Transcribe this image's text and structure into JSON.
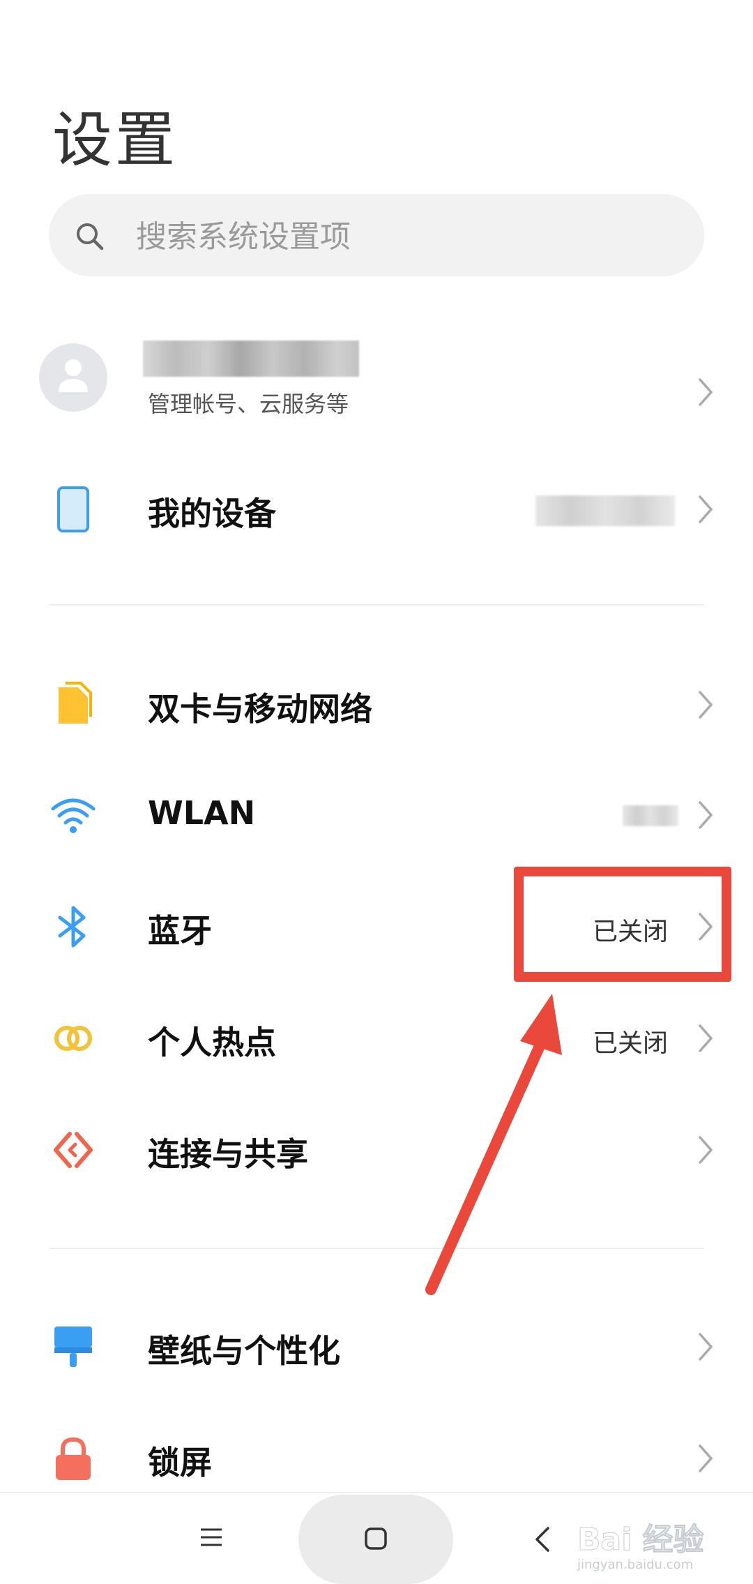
{
  "page": {
    "title": "设置"
  },
  "search": {
    "placeholder": "搜索系统设置项",
    "icon": "search-icon"
  },
  "account": {
    "subtitle": "管理帐号、云服务等",
    "icon": "avatar-icon"
  },
  "device": {
    "label": "我的设备",
    "icon": "phone-icon"
  },
  "network": [
    {
      "label": "双卡与移动网络",
      "value": "",
      "icon": "sim-card-icon",
      "color": "#ffc233"
    },
    {
      "label": "WLAN",
      "value": "",
      "icon": "wifi-icon",
      "color": "#3a9ff2"
    },
    {
      "label": "蓝牙",
      "value": "已关闭",
      "icon": "bluetooth-icon",
      "color": "#3a9ff2"
    },
    {
      "label": "个人热点",
      "value": "已关闭",
      "icon": "hotspot-icon",
      "color": "#f2c23a"
    },
    {
      "label": "连接与共享",
      "value": "",
      "icon": "connection-share-icon",
      "color": "#f0654e"
    }
  ],
  "personal": [
    {
      "label": "壁纸与个性化",
      "icon": "wallpaper-icon",
      "color": "#3a9ff2"
    },
    {
      "label": "锁屏",
      "icon": "lock-icon",
      "color": "#f5705c"
    }
  ],
  "annotation": {
    "color": "#e9483b"
  },
  "navbar": {
    "menu": "menu-icon",
    "home": "home-icon",
    "back": "back-icon"
  },
  "watermark": {
    "text": "Bai 经验",
    "sub": "jingyan.baidu.com"
  }
}
